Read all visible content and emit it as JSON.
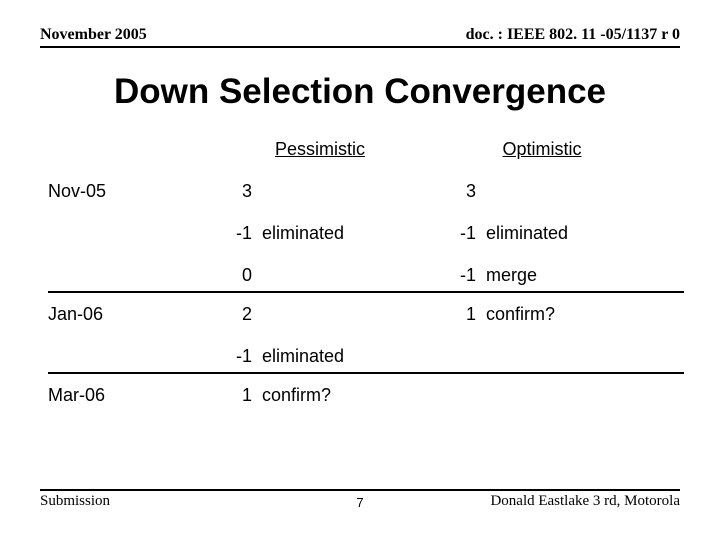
{
  "header": {
    "left": "November 2005",
    "right": "doc. : IEEE 802. 11 -05/1137 r 0"
  },
  "title": "Down Selection Convergence",
  "columns": {
    "pessimistic": "Pessimistic",
    "optimistic": "Optimistic"
  },
  "rows": {
    "nov05": {
      "label": "Nov-05",
      "p_start": "3",
      "o_start": "3",
      "p_elim_n": "-1",
      "p_elim_t": "eliminated",
      "o_elim_n": "-1",
      "o_elim_t": "eliminated",
      "p_merge_n": "0",
      "o_merge_n": "-1",
      "o_merge_t": "merge"
    },
    "jan06": {
      "label": "Jan-06",
      "p_start": "2",
      "o_conf_n": "1",
      "o_conf_t": "confirm?",
      "p_elim_n": "-1",
      "p_elim_t": "eliminated"
    },
    "mar06": {
      "label": "Mar-06",
      "p_conf_n": "1",
      "p_conf_t": "confirm?"
    }
  },
  "footer": {
    "left": "Submission",
    "right": "Donald Eastlake 3 rd, Motorola",
    "page_number": "7"
  }
}
